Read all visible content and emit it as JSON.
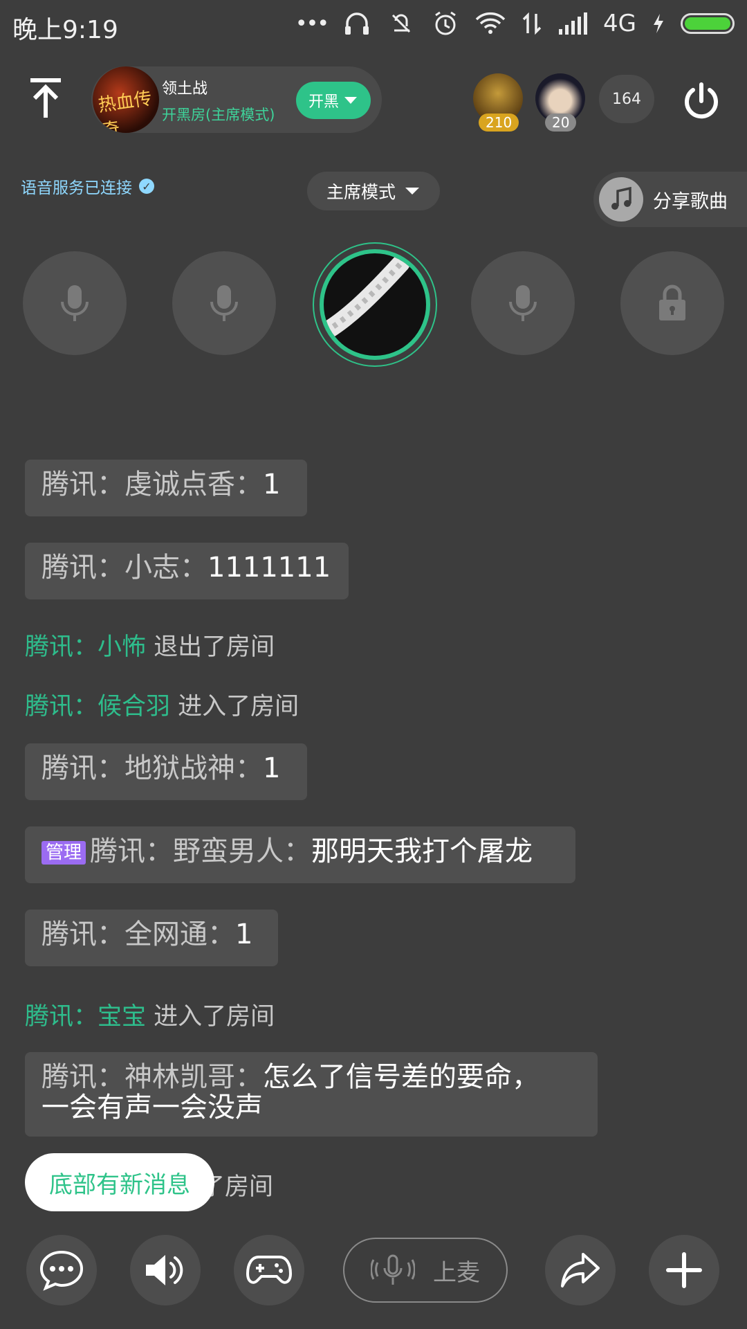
{
  "status_bar": {
    "time": "晚上9:19",
    "network": "4G",
    "icons": [
      "more-dots-icon",
      "headphones-icon",
      "vibrate-icon",
      "alarm-icon",
      "wifi-icon",
      "data-arrows-icon",
      "signal-icon",
      "charging-icon",
      "battery-icon"
    ]
  },
  "header": {
    "room": {
      "name": "领土战",
      "mode": "开黑房(主席模式)",
      "cover_text": "热血传奇",
      "action_label": "开黑"
    },
    "members": [
      {
        "badge": "210",
        "badge_color": "#d9a41f"
      },
      {
        "badge": "20",
        "badge_color": "#8a8a8a"
      }
    ],
    "online_count": "164"
  },
  "voice": {
    "status": "语音服务已连接",
    "mode_label": "主席模式",
    "share_label": "分享歌曲"
  },
  "seats": [
    "mic-empty",
    "mic-empty",
    "host",
    "mic-empty",
    "locked"
  ],
  "chat": {
    "prefix": "腾讯：",
    "messages": [
      {
        "type": "chat",
        "user": "虔诚点香：",
        "text": "1"
      },
      {
        "type": "chat",
        "user": "小志：",
        "text": "1111111"
      },
      {
        "type": "system",
        "user": "小怖",
        "action": "退出了房间"
      },
      {
        "type": "system",
        "user": "候合羽",
        "action": "进入了房间"
      },
      {
        "type": "chat",
        "user": "地狱战神：",
        "text": "1"
      },
      {
        "type": "chat",
        "tag": "管理",
        "user": "野蛮男人：",
        "text": "那明天我打个屠龙"
      },
      {
        "type": "chat",
        "user": "全网通：",
        "text": "1"
      },
      {
        "type": "system",
        "user": "宝宝",
        "action": "进入了房间"
      },
      {
        "type": "chat",
        "user": "神林凯哥：",
        "text": "怎么了信号差的要命，",
        "text2": "一会有声一会没声"
      },
      {
        "type": "system_partial",
        "action": "了房间"
      }
    ]
  },
  "new_message_toast": "底部有新消息",
  "bottom_bar": {
    "mic_label": "上麦"
  },
  "colors": {
    "accent": "#2ec389",
    "background": "#3d3d3d",
    "admin": "#9b6cf2",
    "voice_status": "#8fd8ff"
  }
}
